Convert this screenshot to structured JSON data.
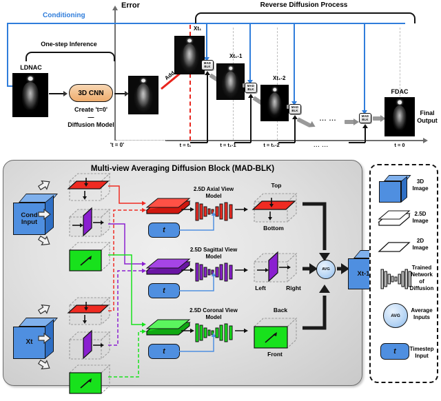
{
  "figure": {
    "top_panel": {
      "axis_y_label": "Error",
      "bracket_inference_label": "One-step Inference",
      "bracket_reverse_label": "Reverse Diffusion Process",
      "conditioning_label": "Conditioning",
      "input_label": "LDNAC",
      "cnn_label": "3D CNN",
      "cnn_caption_line1": "Create 't=0'",
      "cnn_caption_dash": "—",
      "cnn_caption_line2": "Diffusion Model",
      "add_noise_label": "Add noise",
      "origin_label": "'t = 0'",
      "output_label": "FDAC",
      "final_output_line1": "Final",
      "final_output_line2": "Output",
      "mad_blk_line1": "MAD",
      "mad_blk_line2": "BLK",
      "ellipsis": "... ...",
      "state_labels": [
        "Xt₁",
        "Xt₁-1",
        "Xt₁-2"
      ],
      "time_labels": [
        "t = t₁",
        "t = t₁-1",
        "t = t₁-2",
        "... ...",
        "t = 0"
      ]
    },
    "mad_panel": {
      "title": "Multi-view Averaging Diffusion Block (MAD-BLK)",
      "input_cond_line1": "Cond",
      "input_cond_line2": "Input",
      "input_xt": "Xt",
      "output_label": "Xt-1",
      "avg_label": "AVG",
      "timestep_label": "t",
      "rows": [
        {
          "model_line1": "2.5D Axial View",
          "model_line2": "Model",
          "color": "#ef2b22",
          "out_top_label": "Top",
          "out_bottom_label": "Bottom"
        },
        {
          "model_line1": "2.5D Sagittal View",
          "model_line2": "Model",
          "color": "#8a1fd0",
          "out_top_label": "Left",
          "out_bottom_label": "Right"
        },
        {
          "model_line1": "2.5D Coronal View",
          "model_line2": "Model",
          "color": "#18e11c",
          "out_top_label": "Back",
          "out_bottom_label": "Front"
        }
      ]
    },
    "legend": {
      "items": [
        {
          "icon": "cube-3d-icon",
          "lines": [
            "3D",
            "Image"
          ]
        },
        {
          "icon": "slab-2p5d-icon",
          "lines": [
            "2.5D",
            "Image"
          ]
        },
        {
          "icon": "plane-2d-icon",
          "lines": [
            "2D",
            "Image"
          ]
        },
        {
          "icon": "network-icon",
          "lines": [
            "Trained",
            "Network",
            "of",
            "Diffusion"
          ]
        },
        {
          "icon": "avg-circle-icon",
          "lines": [
            "Average",
            "Inputs"
          ]
        },
        {
          "icon": "timestep-pill-icon",
          "lines": [
            "Timestep",
            "Input"
          ]
        }
      ],
      "avg_text": "AVG",
      "timestep_text": "t"
    },
    "colors": {
      "conditioning_blue": "#2f7ddb",
      "noise_red": "#e8241c",
      "axial_red": "#ef2b22",
      "sagittal_purple": "#8a1fd0",
      "coronal_green": "#18e11c",
      "cnn_orange": "#f3c08a",
      "cube_blue": "#4f8fe0"
    }
  }
}
